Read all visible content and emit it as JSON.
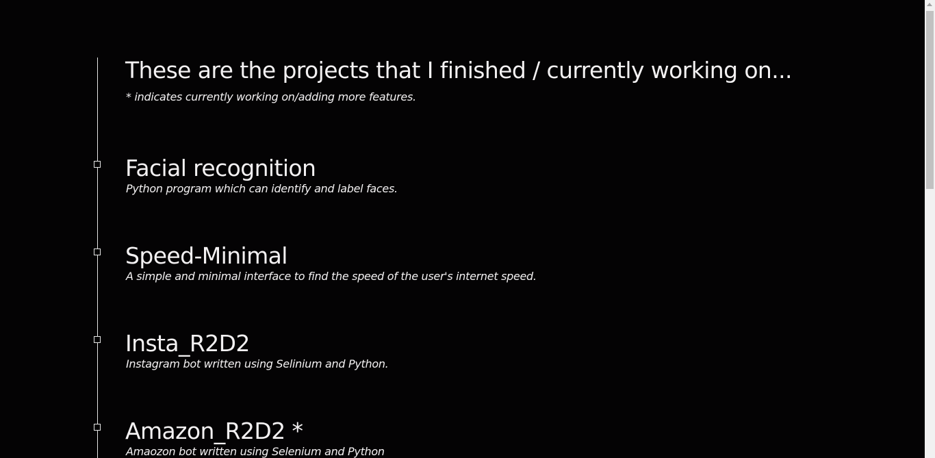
{
  "header": {
    "title": "These are the projects that I finished / currently working on...",
    "note": "* indicates currently working on/adding more features."
  },
  "projects": [
    {
      "title": "Facial recognition",
      "description": "Python program which can identify and label faces."
    },
    {
      "title": "Speed-Minimal",
      "description": "A simple and minimal interface to find the speed of the user's internet speed."
    },
    {
      "title": "Insta_R2D2",
      "description": "Instagram bot written using Selinium and Python."
    },
    {
      "title": "Amazon_R2D2 *",
      "description": "Amaozon bot written using Selenium and Python"
    }
  ],
  "colors": {
    "background": "#040304",
    "text": "#f3f1f2",
    "timeline": "#e6e6e6"
  }
}
